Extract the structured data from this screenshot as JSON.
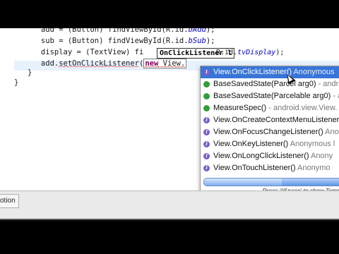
{
  "editor": {
    "line0": {
      "lead": "      add = (Button) findViewById(R.id.",
      "field": "bAdd",
      "tail": ");"
    },
    "line1": {
      "lead": "      sub = (Button) findViewById(R.id.",
      "field": "bSub",
      "tail": ");"
    },
    "line2": {
      "lead": "      display = (TextView) fi",
      "tail_field": "tvDisplay",
      "tail": ");"
    },
    "line3": {
      "lead": "      add.",
      "method": "setOnClickListener",
      "open": "(",
      "kw": "new",
      "typed": " View."
    },
    "line4": {
      "text": "   }"
    },
    "line5": {
      "text": "}"
    }
  },
  "param_hint": {
    "text": "OnClickListener l"
  },
  "param_hint_tail": {
    "text": ".R.id."
  },
  "autocomplete": {
    "items": [
      {
        "icon": "interface-icon",
        "label": "View.OnClickListener()",
        "muted": " Anonymous",
        "selected": true
      },
      {
        "icon": "method-icon",
        "label": "BaseSavedState(Parcel arg0)",
        "muted": " - android",
        "selected": false
      },
      {
        "icon": "method-icon",
        "label": "BaseSavedState(Parcelable arg0)",
        "muted": " - and",
        "selected": false
      },
      {
        "icon": "method-icon",
        "label": "MeasureSpec()",
        "muted": " - android.view.View.",
        "selected": false
      },
      {
        "icon": "interface-icon",
        "label": "View.OnCreateContextMenuListener",
        "muted": "",
        "selected": false
      },
      {
        "icon": "interface-icon",
        "label": "View.OnFocusChangeListener()",
        "muted": " Anon",
        "selected": false
      },
      {
        "icon": "interface-icon",
        "label": "View.OnKeyListener()",
        "muted": " Anonymous l",
        "selected": false
      },
      {
        "icon": "interface-icon",
        "label": "View.OnLongClickListener()",
        "muted": " Anony",
        "selected": false
      },
      {
        "icon": "interface-icon",
        "label": "View.OnTouchListener()",
        "muted": " Anonymo",
        "selected": false
      }
    ],
    "progress": 0.55,
    "status": "Press '^Space' to show Templ"
  },
  "bottom": {
    "tab_label": "otion"
  },
  "colors": {
    "selection": "#3875d7",
    "field": "#0000c0",
    "keyword": "#7f0055"
  }
}
